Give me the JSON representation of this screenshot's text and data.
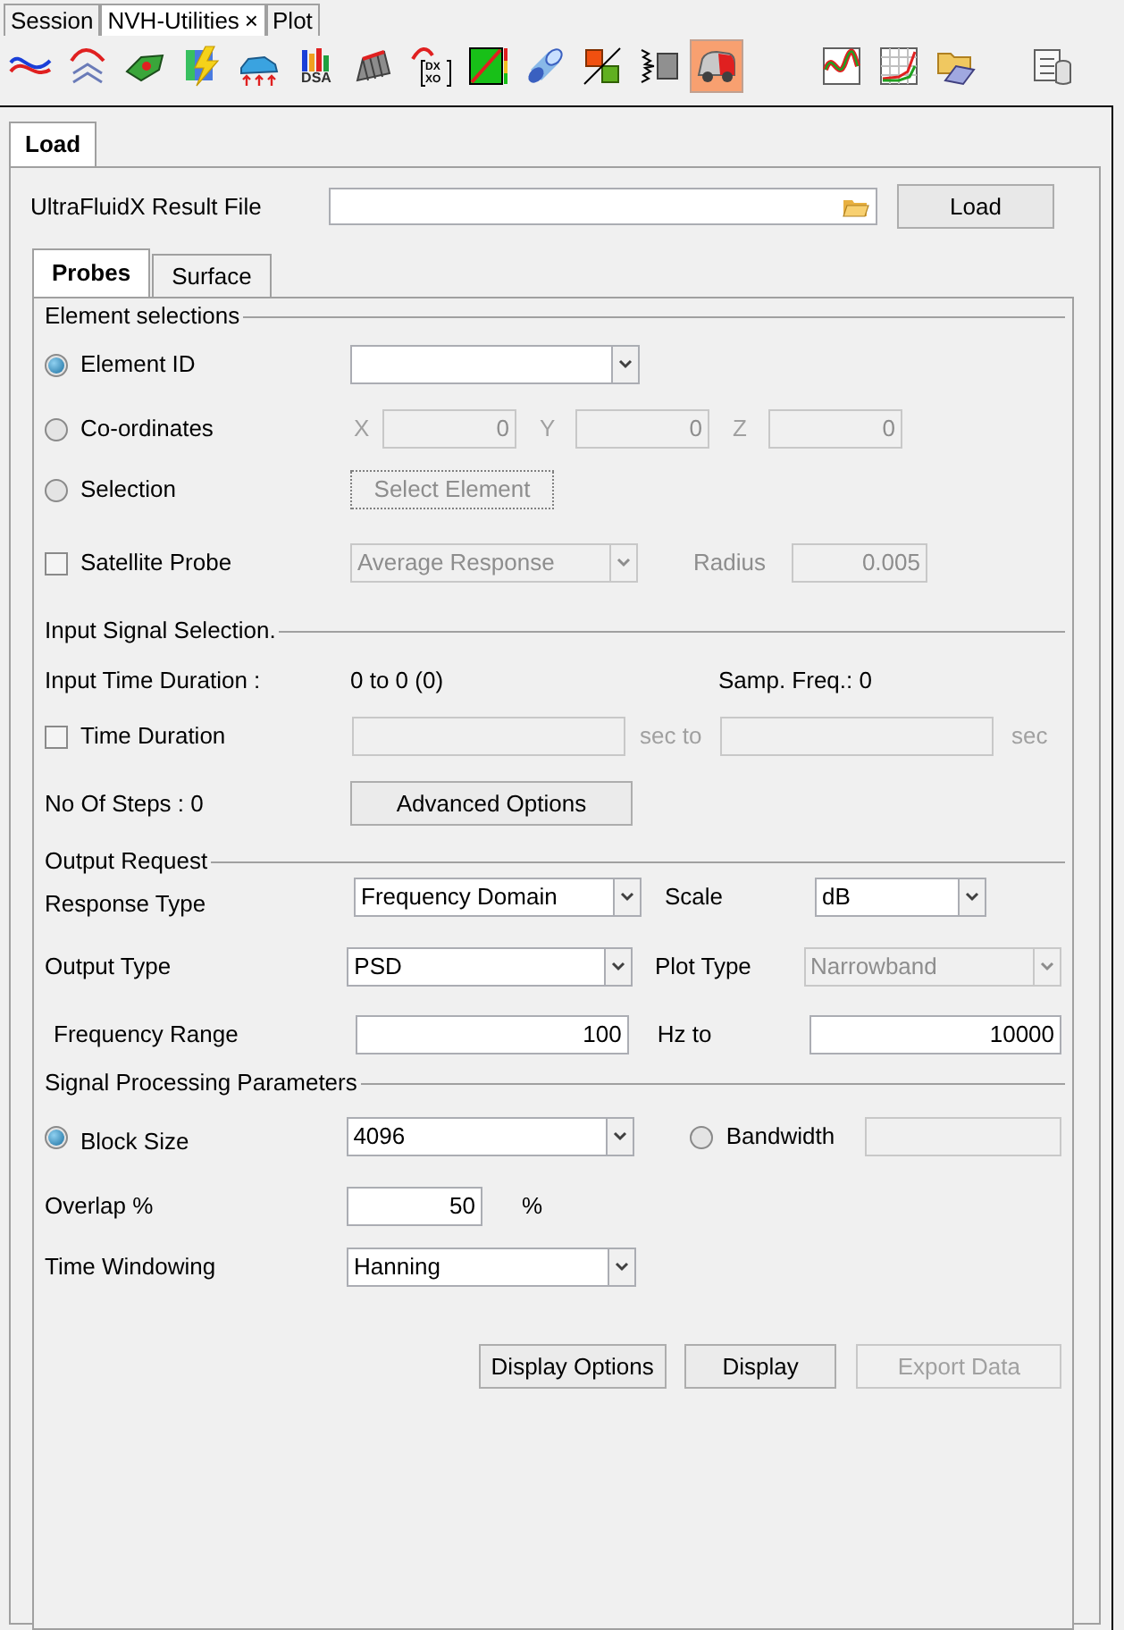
{
  "top_tabs": [
    {
      "label": "Session",
      "selected": false
    },
    {
      "label": "NVH-Utilities",
      "selected": true,
      "close": "×"
    },
    {
      "label": "Plot",
      "selected": false
    }
  ],
  "toolbar_groups": [
    [
      {
        "kind": "curves",
        "selected": false
      },
      {
        "kind": "waves",
        "selected": false
      },
      {
        "kind": "part",
        "selected": false
      },
      {
        "kind": "lightning",
        "selected": false
      },
      {
        "kind": "car_arrows",
        "selected": false
      },
      {
        "kind": "bars",
        "selected": false,
        "label": "DSA"
      },
      {
        "kind": "frame",
        "selected": false
      },
      {
        "kind": "dxxo",
        "selected": false,
        "lines": [
          "DX",
          "XO"
        ]
      },
      {
        "kind": "gradient",
        "selected": false
      },
      {
        "kind": "cylinder",
        "selected": false
      },
      {
        "kind": "cubes",
        "selected": false
      },
      {
        "kind": "spring",
        "selected": false
      },
      {
        "kind": "car",
        "selected": true
      }
    ],
    [
      {
        "kind": "line_chart",
        "selected": false
      },
      {
        "kind": "grid_chart",
        "selected": false
      },
      {
        "kind": "folder",
        "selected": false
      }
    ],
    [
      {
        "kind": "database",
        "selected": false
      }
    ]
  ],
  "load_tab": {
    "label": "Load",
    "selected": true
  },
  "result_file": {
    "label": "UltraFluidX Result File",
    "button": "Load"
  },
  "sub_tabs": [
    {
      "label": "Probes",
      "selected": true
    },
    {
      "label": "Surface",
      "selected": false
    }
  ],
  "element_selections": {
    "title": "Element selections",
    "options": [
      {
        "kind": "element_id",
        "label": "Element ID",
        "selected": true
      },
      {
        "kind": "coordinates",
        "label": "Co-ordinates",
        "selected": false,
        "fields": [
          {
            "label": "X",
            "value": "0"
          },
          {
            "label": "Y",
            "value": "0"
          },
          {
            "label": "Z",
            "value": "0"
          }
        ]
      },
      {
        "kind": "selection",
        "label": "Selection",
        "selected": false,
        "button": "Select Element"
      }
    ],
    "satellite_probe": {
      "label": "Satellite Probe",
      "checked": false,
      "mode": "Average Response",
      "radius_label": "Radius",
      "radius": "0.005"
    }
  },
  "input_signal": {
    "title": "Input Signal Selection.",
    "duration_label": "Input Time Duration :",
    "duration_value": "0 to 0 (0)",
    "samp_freq": "Samp. Freq.: 0",
    "time_duration": {
      "label": "Time Duration",
      "checked": false,
      "separator": "sec to",
      "unit": "sec"
    },
    "steps": "No Of Steps : 0",
    "advanced_button": "Advanced Options"
  },
  "output_request": {
    "title": "Output Request",
    "response_type": {
      "label": "Response Type",
      "value": "Frequency Domain"
    },
    "scale": {
      "label": "Scale",
      "value": "dB"
    },
    "output_type": {
      "label": "Output Type",
      "value": "PSD"
    },
    "plot_type": {
      "label": "Plot Type",
      "value": "Narrowband",
      "disabled": true
    },
    "frequency_range": {
      "label": "Frequency Range",
      "from": "100",
      "separator": "Hz to",
      "to": "10000"
    }
  },
  "signal_processing": {
    "title": "Signal Processing Parameters",
    "modes": [
      {
        "label": "Block Size",
        "selected": true,
        "value": "4096"
      },
      {
        "label": "Bandwidth",
        "selected": false
      }
    ],
    "overlap": {
      "label": "Overlap %",
      "value": "50",
      "unit": "%"
    },
    "time_windowing": {
      "label": "Time Windowing",
      "value": "Hanning"
    }
  },
  "buttons": [
    {
      "label": "Display Options",
      "disabled": false
    },
    {
      "label": "Display",
      "disabled": false
    },
    {
      "label": "Export Data",
      "disabled": true
    }
  ]
}
